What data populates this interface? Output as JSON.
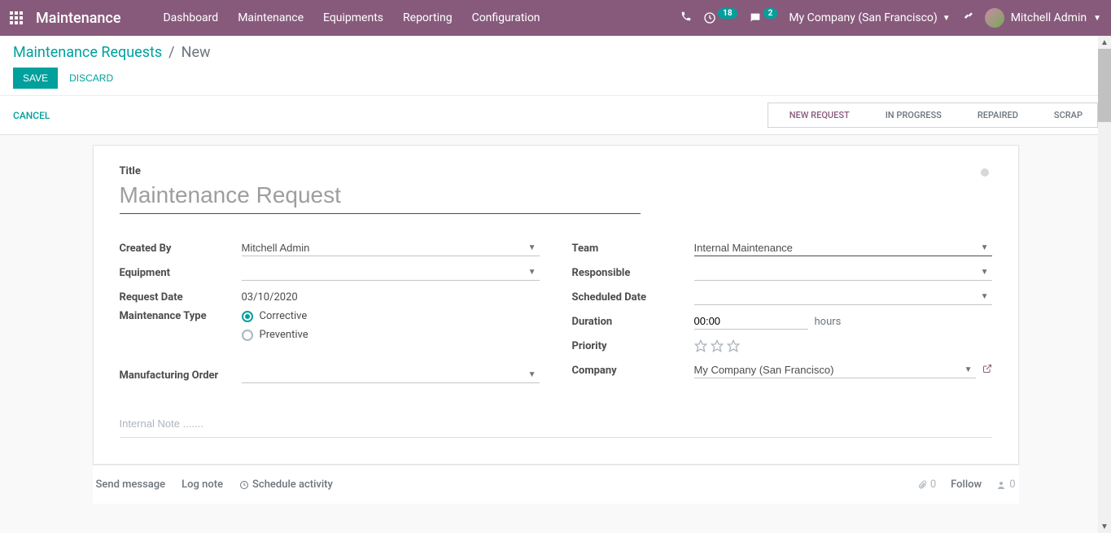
{
  "topbar": {
    "app_name": "Maintenance",
    "nav": [
      "Dashboard",
      "Maintenance",
      "Equipments",
      "Reporting",
      "Configuration"
    ],
    "activity_badge": "18",
    "messages_badge": "2",
    "company": "My Company (San Francisco)",
    "user": "Mitchell Admin"
  },
  "breadcrumb": {
    "parent": "Maintenance Requests",
    "current": "New"
  },
  "actions": {
    "save": "SAVE",
    "discard": "DISCARD",
    "cancel": "CANCEL"
  },
  "stages": [
    "NEW REQUEST",
    "IN PROGRESS",
    "REPAIRED",
    "SCRAP"
  ],
  "active_stage": 0,
  "form": {
    "title_label": "Title",
    "title_placeholder": "Maintenance Request",
    "created_by_label": "Created By",
    "created_by_value": "Mitchell Admin",
    "equipment_label": "Equipment",
    "equipment_value": "",
    "request_date_label": "Request Date",
    "request_date_value": "03/10/2020",
    "maint_type_label": "Maintenance Type",
    "maint_type_corrective": "Corrective",
    "maint_type_preventive": "Preventive",
    "mfg_order_label": "Manufacturing Order",
    "mfg_order_value": "",
    "team_label": "Team",
    "team_value": "Internal Maintenance",
    "responsible_label": "Responsible",
    "responsible_value": "",
    "scheduled_date_label": "Scheduled Date",
    "scheduled_date_value": "",
    "duration_label": "Duration",
    "duration_value": "00:00",
    "duration_unit": "hours",
    "priority_label": "Priority",
    "company_label": "Company",
    "company_value": "My Company (San Francisco)",
    "internal_note_placeholder": "Internal Note ......."
  },
  "chatter": {
    "send_message": "Send message",
    "log_note": "Log note",
    "schedule_activity": "Schedule activity",
    "attachments": "0",
    "follow": "Follow",
    "followers": "0"
  }
}
